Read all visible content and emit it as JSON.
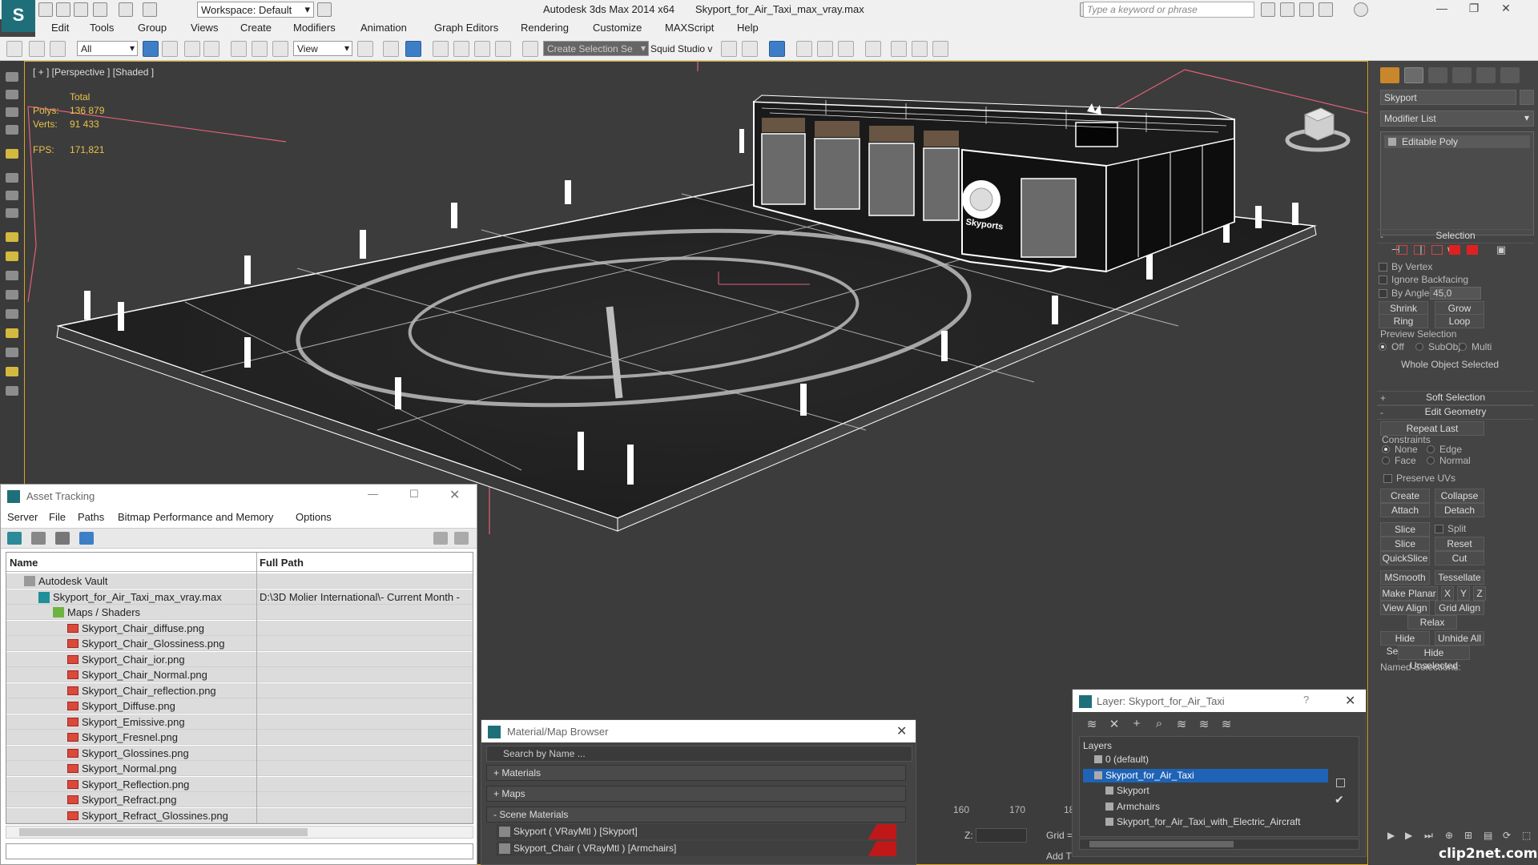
{
  "titlebar": {
    "workspace": "Workspace: Default",
    "app_title": "Autodesk 3ds Max  2014 x64",
    "file_title": "Skyport_for_Air_Taxi_max_vray.max",
    "search_placeholder": "Type a keyword or phrase"
  },
  "menubar": [
    "Edit",
    "Tools",
    "Group",
    "Views",
    "Create",
    "Modifiers",
    "Animation",
    "Graph Editors",
    "Rendering",
    "Customize",
    "MAXScript",
    "Help"
  ],
  "toolbar": {
    "selection_filter": "All",
    "ref_coord": "View",
    "named_selection": "Create Selection Se",
    "squid_label": "Squid Studio v"
  },
  "viewport": {
    "label": "[ + ] [Perspective ] [Shaded ]",
    "stats_header": "Total",
    "polys_label": "Polys:",
    "polys_value": "136 879",
    "verts_label": "Verts:",
    "verts_value": "91 433",
    "fps_label": "FPS:",
    "fps_value": "171,821",
    "building_sign": "Skyports"
  },
  "command_panel": {
    "object_name": "Skyport",
    "modifier_list": "Modifier List",
    "stack_item": "Editable Poly",
    "selection": {
      "title": "Selection",
      "by_vertex": "By Vertex",
      "ignore_backfacing": "Ignore Backfacing",
      "by_angle": "By Angle:",
      "angle_value": "45,0",
      "shrink": "Shrink",
      "grow": "Grow",
      "ring": "Ring",
      "loop": "Loop",
      "preview_selection": "Preview Selection",
      "preview_off": "Off",
      "preview_subobj": "SubObj",
      "preview_multi": "Multi",
      "status": "Whole Object Selected"
    },
    "soft_selection": "Soft Selection",
    "edit_geometry": {
      "title": "Edit Geometry",
      "repeat_last": "Repeat Last",
      "constraints": "Constraints",
      "none": "None",
      "edge": "Edge",
      "face": "Face",
      "normal": "Normal",
      "preserve_uvs": "Preserve UVs",
      "create": "Create",
      "collapse": "Collapse",
      "attach": "Attach",
      "detach": "Detach",
      "slice_plane": "Slice Plane",
      "split": "Split",
      "slice": "Slice",
      "reset_plane": "Reset Plane",
      "quickslice": "QuickSlice",
      "cut": "Cut",
      "msmooth": "MSmooth",
      "tessellate": "Tessellate",
      "make_planar": "Make Planar",
      "x": "X",
      "y": "Y",
      "z": "Z",
      "view_align": "View Align",
      "grid_align": "Grid Align",
      "relax": "Relax",
      "hide_selected": "Hide Selected",
      "unhide_all": "Unhide All",
      "hide_unselected": "Hide Unselected",
      "named_selections": "Named Selections:"
    }
  },
  "asset_tracking": {
    "title": "Asset Tracking",
    "menu": [
      "Server",
      "File",
      "Paths",
      "Bitmap Performance and Memory",
      "Options"
    ],
    "col_name": "Name",
    "col_path": "Full Path",
    "rows": [
      {
        "name": "Autodesk Vault",
        "path": "",
        "indent": 0,
        "icon": "vault"
      },
      {
        "name": "Skyport_for_Air_Taxi_max_vray.max",
        "path": "D:\\3D Molier International\\- Current Month -",
        "indent": 1,
        "icon": "max"
      },
      {
        "name": "Maps / Shaders",
        "path": "",
        "indent": 2,
        "icon": "folder"
      },
      {
        "name": "Skyport_Chair_diffuse.png",
        "path": "",
        "indent": 3,
        "icon": "png"
      },
      {
        "name": "Skyport_Chair_Glossiness.png",
        "path": "",
        "indent": 3,
        "icon": "png"
      },
      {
        "name": "Skyport_Chair_ior.png",
        "path": "",
        "indent": 3,
        "icon": "png"
      },
      {
        "name": "Skyport_Chair_Normal.png",
        "path": "",
        "indent": 3,
        "icon": "png"
      },
      {
        "name": "Skyport_Chair_reflection.png",
        "path": "",
        "indent": 3,
        "icon": "png"
      },
      {
        "name": "Skyport_Diffuse.png",
        "path": "",
        "indent": 3,
        "icon": "png"
      },
      {
        "name": "Skyport_Emissive.png",
        "path": "",
        "indent": 3,
        "icon": "png"
      },
      {
        "name": "Skyport_Fresnel.png",
        "path": "",
        "indent": 3,
        "icon": "png"
      },
      {
        "name": "Skyport_Glossines.png",
        "path": "",
        "indent": 3,
        "icon": "png"
      },
      {
        "name": "Skyport_Normal.png",
        "path": "",
        "indent": 3,
        "icon": "png"
      },
      {
        "name": "Skyport_Reflection.png",
        "path": "",
        "indent": 3,
        "icon": "png"
      },
      {
        "name": "Skyport_Refract.png",
        "path": "",
        "indent": 3,
        "icon": "png"
      },
      {
        "name": "Skyport_Refract_Glossines.png",
        "path": "",
        "indent": 3,
        "icon": "png"
      }
    ]
  },
  "material_browser": {
    "title": "Material/Map Browser",
    "search_placeholder": "Search by Name ...",
    "groups": [
      "+ Materials",
      "+ Maps",
      "- Scene Materials"
    ],
    "materials": [
      "Skyport  ( VRayMtl )  [Skyport]",
      "Skyport_Chair  ( VRayMtl )  [Armchairs]"
    ]
  },
  "timeline": {
    "ticks": [
      "160",
      "170",
      "18"
    ],
    "z_label": "Z:",
    "grid_label": "Grid =",
    "add_time": "Add T"
  },
  "layer_window": {
    "title": "Layer: Skyport_for_Air_Taxi",
    "help": "?",
    "header": "Layers",
    "rows": [
      {
        "name": "0 (default)",
        "selected": false,
        "indent": 1
      },
      {
        "name": "Skyport_for_Air_Taxi",
        "selected": true,
        "indent": 1
      },
      {
        "name": "Skyport",
        "selected": false,
        "indent": 2
      },
      {
        "name": "Armchairs",
        "selected": false,
        "indent": 2
      },
      {
        "name": "Skyport_for_Air_Taxi_with_Electric_Aircraft",
        "selected": false,
        "indent": 2
      }
    ]
  },
  "watermark": "clip2net.com",
  "colors": {
    "accent_selection": "#1e63b6",
    "viewport_border": "#d8a520",
    "stats_text": "#e8c24a",
    "wireframe": "#ffffff",
    "bounding_box": "#e0607a"
  }
}
